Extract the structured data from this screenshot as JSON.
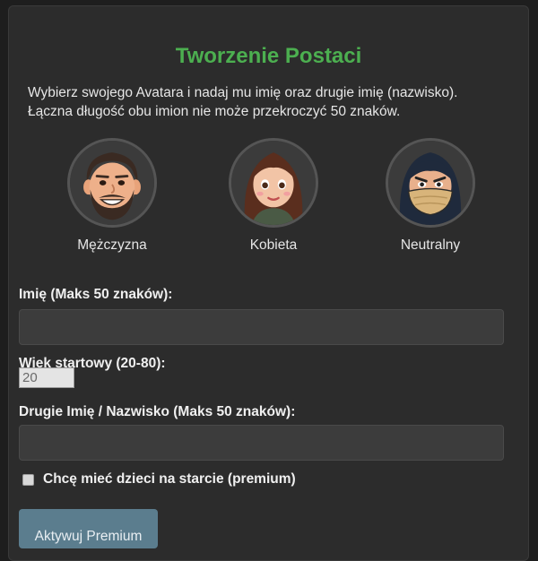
{
  "page": {
    "title": "Tworzenie Postaci",
    "intro_line1": "Wybierz swojego Avatara i nadaj mu imię oraz drugie imię (nazwisko).",
    "intro_line2": "Łączna długość obu imion nie może przekroczyć 50 znaków."
  },
  "avatars": [
    {
      "label": "Mężczyzna",
      "icon": "male-avatar-icon"
    },
    {
      "label": "Kobieta",
      "icon": "female-avatar-icon"
    },
    {
      "label": "Neutralny",
      "icon": "neutral-avatar-icon"
    }
  ],
  "form": {
    "first_name_label": "Imię (Maks 50 znaków):",
    "first_name_value": "",
    "age_label": "Wiek startowy (20-80):",
    "age_value": "20",
    "last_name_label": "Drugie Imię / Nazwisko (Maks 50 znaków):",
    "last_name_value": "",
    "children_label": "Chcę mieć dzieci na starcie (premium)",
    "children_checked": false,
    "premium_button_label": "Aktywuj Premium"
  },
  "colors": {
    "title": "#4caf50",
    "panel": "#2c2c2c",
    "background": "#1e1e1e",
    "button": "#5b7d8e"
  }
}
